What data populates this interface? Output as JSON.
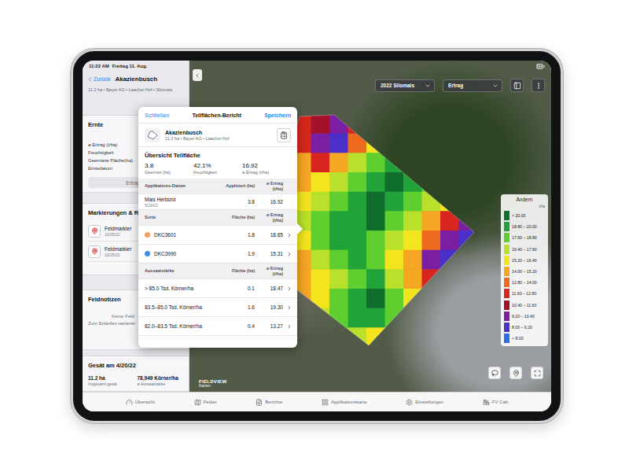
{
  "status_bar": {
    "time": "11:22 AM",
    "date": "Freitag 11. Aug."
  },
  "sidebar": {
    "back": "Zurück",
    "title": "Akazienbusch",
    "subtitle": "11.2 ha • Bayer AG • Laacher Hof • Silomais",
    "harvest": {
      "title": "Ernte",
      "rows": [
        "ø Ertrag (t/ha)",
        "Feuchtigkeit",
        "Geerntete Fläche(ha)",
        "Erntedatum"
      ],
      "button": "Ertrag"
    },
    "markers": {
      "title": "Markierungen & Re",
      "items": [
        {
          "label": "Feldmarkier",
          "date": "10/25/22"
        },
        {
          "label": "Feldmarkier",
          "date": "10/25/22"
        }
      ]
    },
    "notes": {
      "title": "Feldnotizen",
      "empty": "Keine Feld",
      "hint": "Zum Erstellen weiterer"
    },
    "seeding": {
      "title": "Gesät am 4/20/22",
      "stats": [
        {
          "value": "11.2 ha",
          "label": "Insgesamt gesät"
        },
        {
          "value": "78,949 Körner/ha",
          "label": "ø Aussaatstärke"
        }
      ]
    }
  },
  "map": {
    "season": "2022 Silomais",
    "layer": "Ertrag",
    "attribution": {
      "logo": "FIELDVIEW",
      "label": "Karten"
    },
    "legend": {
      "action": "Ändern",
      "unit": "t/ha",
      "items": [
        {
          "label": "> 20.00",
          "color": "#0f6e2b"
        },
        {
          "label": "18.80 – 20.00",
          "color": "#22a33a"
        },
        {
          "label": "17.60 – 18.80",
          "color": "#5fcf2f"
        },
        {
          "label": "16.40 – 17.60",
          "color": "#b9e02a"
        },
        {
          "label": "15.20 – 16.40",
          "color": "#f2e51f"
        },
        {
          "label": "14.00 – 15.20",
          "color": "#f5a623"
        },
        {
          "label": "12.80 – 14.00",
          "color": "#ee6a1f"
        },
        {
          "label": "11.60 – 12.80",
          "color": "#d7261e"
        },
        {
          "label": "10.40 – 11.60",
          "color": "#a3122a"
        },
        {
          "label": "9.20 – 10.40",
          "color": "#7b1fa2"
        },
        {
          "label": "8.00 – 9.20",
          "color": "#4b2fc9"
        },
        {
          "label": "< 8.00",
          "color": "#2a6fe0"
        }
      ]
    },
    "yield_grid": [
      [
        14,
        13,
        12,
        11,
        9.5,
        12,
        13,
        15,
        16,
        17,
        18,
        18
      ],
      [
        13,
        12.5,
        12,
        10,
        9,
        13,
        16,
        17,
        18,
        19,
        19,
        18
      ],
      [
        12,
        13,
        14,
        12,
        14,
        17,
        18,
        19,
        19.5,
        20.5,
        19,
        17
      ],
      [
        13,
        14,
        15,
        16,
        17,
        18,
        19,
        20,
        19,
        18,
        17,
        16
      ],
      [
        14,
        15,
        16,
        17,
        18,
        19,
        20.5,
        19,
        18,
        17,
        16,
        15
      ],
      [
        13,
        14,
        17,
        18,
        19,
        19.5,
        20,
        18,
        17,
        15,
        12,
        10
      ],
      [
        12,
        13,
        16,
        18,
        19,
        19,
        18,
        17,
        16,
        13,
        9.5,
        8.5
      ],
      [
        11,
        12,
        15,
        17,
        18,
        19,
        18,
        16,
        14,
        10,
        8.5,
        7.5
      ],
      [
        12,
        13,
        14,
        16,
        17,
        18.5,
        19,
        17,
        15,
        12,
        9,
        8
      ],
      [
        13,
        14,
        15,
        16,
        18,
        19,
        20.5,
        18,
        16,
        14,
        12,
        11
      ],
      [
        14,
        15,
        16,
        17,
        18,
        19,
        19,
        18,
        17,
        16,
        15,
        14
      ],
      [
        15,
        16,
        17,
        17,
        18,
        17,
        16,
        15,
        14,
        13,
        12,
        12
      ]
    ]
  },
  "report": {
    "close": "Schließen",
    "title": "Teilflächen-Bericht",
    "save": "Speichern",
    "field": {
      "name": "Akazienbusch",
      "meta": "11.2 ha • Bayer AG • Laacher Hof"
    },
    "overview": {
      "title": "Übersicht Teilfläche",
      "stats": [
        {
          "value": "3.8",
          "label": "Geerntet (ha)"
        },
        {
          "value": "42.1%",
          "label": "Feuchtigkeit"
        },
        {
          "value": "16.92",
          "label": "ø Ertrag (t/ha)"
        }
      ]
    },
    "sections": [
      {
        "columns": [
          "Applikations-Datum",
          "Appliziert (ha)",
          "ø Ertrag (t/ha)"
        ],
        "rows": [
          {
            "label": "Mais Herbizid",
            "sub": "5/19/22",
            "area": "3.8",
            "yield": "16.92",
            "navigable": false
          }
        ]
      },
      {
        "columns": [
          "Sorte",
          "Fläche (ha)",
          "ø Ertrag (t/ha)"
        ],
        "rows": [
          {
            "label": "DKC3601",
            "color": "#f0a45c",
            "area": "1.8",
            "yield": "18.65",
            "navigable": true
          },
          {
            "label": "DKC3990",
            "color": "#3f8ee8",
            "area": "1.9",
            "yield": "15.31",
            "navigable": true
          }
        ]
      },
      {
        "columns": [
          "Aussaatstärke",
          "Fläche (ha)",
          "ø Ertrag (t/ha)"
        ],
        "rows": [
          {
            "label": "> 85.0 Tsd. Körner/ha",
            "area": "0.1",
            "yield": "18.47",
            "navigable": true
          },
          {
            "label": "83.5–85.0 Tsd. Körner/ha",
            "area": "1.6",
            "yield": "19.30",
            "navigable": true
          },
          {
            "label": "82.0–83.5 Tsd. Körner/ha",
            "area": "0.4",
            "yield": "13.27",
            "navigable": true
          }
        ]
      }
    ]
  },
  "tabs": [
    {
      "label": "Übersicht",
      "selected": false
    },
    {
      "label": "Felder",
      "selected": false
    },
    {
      "label": "Berichte",
      "selected": false
    },
    {
      "label": "Applikationskarte",
      "selected": false
    },
    {
      "label": "Einstellungen",
      "selected": false
    },
    {
      "label": "FV Cab",
      "selected": false
    }
  ]
}
